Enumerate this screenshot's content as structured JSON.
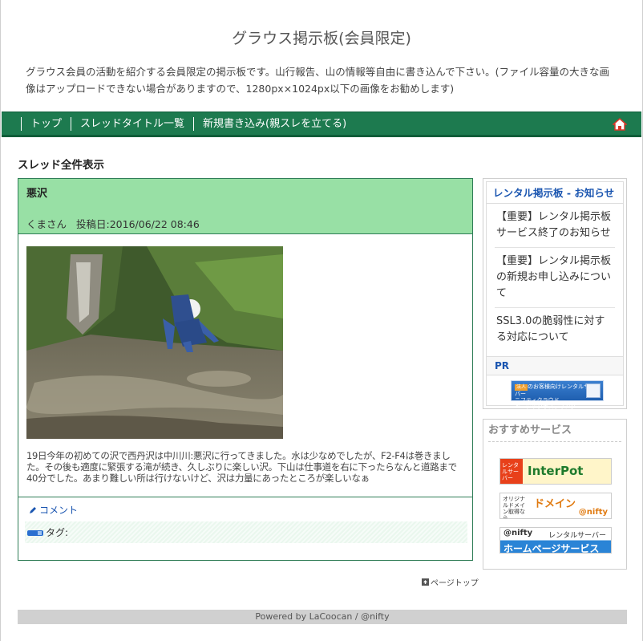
{
  "site": {
    "title": "グラウス掲示板(会員限定)",
    "description": "グラウス会員の活動を紹介する会員限定の掲示板です。山行報告、山の情報等自由に書き込んで下さい。(ファイル容量の大きな画像はアップロードできない場合がありますので、1280px×1024px以下の画像をお勧めします)"
  },
  "nav": {
    "items": [
      {
        "label": "トップ"
      },
      {
        "label": "スレッドタイトル一覧"
      },
      {
        "label": "新規書き込み(親スレを立てる)"
      }
    ],
    "home_icon": "home-icon"
  },
  "main": {
    "section_heading": "スレッド全件表示",
    "thread": {
      "title": "悪沢",
      "author": "くまさん",
      "posted_label": "投稿日:2016/06/22 08:46",
      "body": "19日今年の初めての沢で西丹沢は中川川:悪沢に行ってきました。水は少なめでしたが、F2-F4は巻きました。その後も適度に緊張する滝が続き、久しぶりに楽しい沢。下山は仕事道を右に下ったらなんと道路まで40分でした。あまり難しい所は行けないけど、沢は力量にあったところが楽しいなぁ",
      "comment_label": "コメント",
      "tag_label": "タグ:"
    },
    "page_top_label": "ページトップ"
  },
  "sidebar": {
    "notice": {
      "title": "レンタル掲示板 - お知らせ",
      "items": [
        {
          "label": "【重要】レンタル掲示板サービス終了のお知らせ"
        },
        {
          "label": "【重要】レンタル掲示板の新規お申し込みについて"
        },
        {
          "label": "SSL3.0の脆弱性に対する対応について"
        }
      ],
      "pr_title": "PR",
      "pr_banner": {
        "badge": "法人",
        "line1": "のお客様向けレンタルサーバー",
        "line2": "ニフティクラウド",
        "line3": "ベーシックホスティング"
      }
    },
    "services": {
      "title": "おすすめサービス",
      "interpot": {
        "side": "レンタルサーバー",
        "text": "InterPot"
      },
      "domain": {
        "side": "オリジナルドメイン取得なら",
        "text": "ドメイン",
        "sub": "@nifty"
      },
      "homepage": {
        "brand": "@nifty",
        "tag": "レンタルサーバー",
        "text": "ホームページサービス"
      }
    }
  },
  "footer": {
    "text": "Powered by LaCoocan / @nifty"
  },
  "colors": {
    "nav_bg": "#1d7a4f",
    "thread_header_bg": "#98e0a5",
    "link": "#1a55b0"
  }
}
